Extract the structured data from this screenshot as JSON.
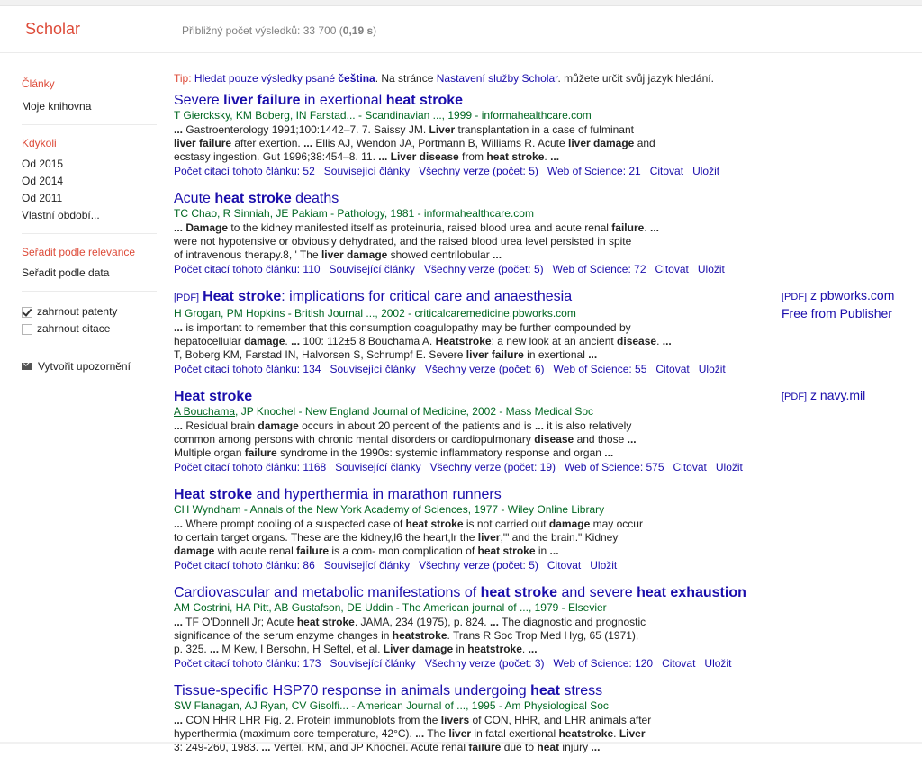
{
  "header": {
    "logo": "Scholar",
    "count_prefix": "Přibližný počet výsledků: 33 700 (",
    "count_time": "0,19 s",
    "count_suffix": ")"
  },
  "sidebar": {
    "articles_label": "Články",
    "my_library": "Moje knihovna",
    "when_label": "Kdykoli",
    "years": [
      "Od 2015",
      "Od 2014",
      "Od 2011",
      "Vlastní období..."
    ],
    "sort_relevance": "Seřadit podle relevance",
    "sort_date": "Seřadit podle data",
    "include_patents": "zahrnout patenty",
    "include_patents_checked": true,
    "include_citations": "zahrnout citace",
    "include_citations_checked": false,
    "create_alert": "Vytvořit upozornění"
  },
  "tip": {
    "label": "Tip:",
    "link1": "Hledat pouze výsledky psané",
    "lang": "čeština",
    "mid": ". Na stránce",
    "link2": "Nastavení služby Scholar",
    "tail": ". můžete určit svůj jazyk hledání."
  },
  "results": [
    {
      "title_html": "Severe <b>liver failure</b> in exertional <b>heat stroke</b>",
      "pdf_tag": "",
      "authors": "T Giercksky, KM Boberg, IN Farstad... - Scandinavian ..., 1999 - informahealthcare.com",
      "snippet_html": "<b>...</b> Gastroenterology 1991;100:1442–7. 7. Saissy JM. <b>Liver</b> transplantation in a case of fulminant<br><b>liver failure</b> after exertion. <b>...</b> Ellis AJ, Wendon JA, Portmann B, Williams R. Acute <b>liver damage</b> and<br>ecstasy ingestion. Gut 1996;38:454–8. 11. <b>...</b> <b>Liver disease</b> from <b>heat stroke</b>. <b>...</b>",
      "footer": [
        "Počet citací tohoto článku: 52",
        "Související články",
        "Všechny verze (počet: 5)",
        "Web of Science: 21",
        "Citovat",
        "Uložit"
      ]
    },
    {
      "title_html": "Acute <b>heat stroke</b> deaths",
      "pdf_tag": "",
      "authors": "TC Chao, R Sinniah, JE Pakiam - Pathology, 1981 - informahealthcare.com",
      "snippet_html": "<b>... Damage</b> to the kidney manifested itself as proteinuria, raised blood urea and acute renal <b>failure</b>. <b>...</b><br>were not hypotensive or obviously dehydrated, and the raised blood urea level persisted in spite<br>of intravenous therapy.8, ' The <b>liver damage</b> showed centrilobular <b>...</b>",
      "footer": [
        "Počet citací tohoto článku: 110",
        "Související články",
        "Všechny verze (počet: 5)",
        "Web of Science: 72",
        "Citovat",
        "Uložit"
      ]
    },
    {
      "title_html": "<b>Heat stroke</b>: implications for critical care and anaesthesia",
      "pdf_tag": "[PDF]",
      "authors": "H Grogan, PM Hopkins - British Journal ..., 2002 - criticalcaremedicine.pbworks.com",
      "snippet_html": "<b>...</b> is important to remember that this consumption coagulopathy may be further compounded by<br>hepatocellular <b>damage</b>. <b>...</b> 100: 112±5 8 Bouchama A. <b>Heatstroke</b>: a new look at an ancient <b>disease</b>. <b>...</b><br>T, Boberg KM, Farstad IN, Halvorsen S, Schrumpf E. Severe <b>liver failure</b> in exertional <b>...</b>",
      "footer": [
        "Počet citací tohoto článku: 134",
        "Související články",
        "Všechny verze (počet: 6)",
        "Web of Science: 55",
        "Citovat",
        "Uložit"
      ]
    },
    {
      "title_html": "<b>Heat stroke</b>",
      "pdf_tag": "",
      "authors_link": "A Bouchama",
      "authors": ", JP Knochel - New England Journal of Medicine, 2002 - Mass Medical Soc",
      "snippet_html": "<b>...</b> Residual brain <b>damage</b> occurs in about 20 percent of the patients and is <b>...</b> it is also relatively<br>common among persons with chronic mental disorders or cardiopulmonary <b>disease</b> and those <b>...</b><br>Multiple organ <b>failure</b> syndrome in the 1990s: systemic inflammatory response and organ <b>...</b>",
      "footer": [
        "Počet citací tohoto článku: 1168",
        "Související články",
        "Všechny verze (počet: 19)",
        "Web of Science: 575",
        "Citovat",
        "Uložit"
      ]
    },
    {
      "title_html": "<b>Heat stroke</b> and hyperthermia in marathon runners",
      "pdf_tag": "",
      "authors": "CH Wyndham - Annals of the New York Academy of Sciences, 1977 - Wiley Online Library",
      "snippet_html": "<b>...</b> Where prompt cooling of a suspected case of <b>heat stroke</b> is not carried out <b>damage</b> may occur<br>to certain target organs. These are the kidney,l6 the heart,lr the <b>liver</b>,'\" and the brain.\" Kidney<br><b>damage</b> with acute renal <b>failure</b> is a com- mon complication of <b>heat stroke</b> in <b>...</b>",
      "footer": [
        "Počet citací tohoto článku: 86",
        "Související články",
        "Všechny verze (počet: 5)",
        "Citovat",
        "Uložit"
      ]
    },
    {
      "title_html": "Cardiovascular and metabolic manifestations of <b>heat stroke</b> and severe <b>heat exhaustion</b>",
      "pdf_tag": "",
      "authors": "AM Costrini, HA Pitt, AB Gustafson, DE Uddin - The American journal of ..., 1979 - Elsevier",
      "snippet_html": "<b>...</b> TF O'Donnell Jr; Acute <b>heat stroke</b>. JAMA, 234 (1975), p. 824. <b>...</b> The diagnostic and prognostic<br>significance of the serum enzyme changes in <b>heatstroke</b>. Trans R Soc Trop Med Hyg, 65 (1971),<br>p. 325. <b>...</b> M Kew, I Bersohn, H Seftel, et al. <b>Liver damage</b> in <b>heatstroke</b>. <b>...</b>",
      "footer": [
        "Počet citací tohoto článku: 173",
        "Související články",
        "Všechny verze (počet: 3)",
        "Web of Science: 120",
        "Citovat",
        "Uložit"
      ]
    },
    {
      "title_html": "Tissue-specific HSP70 response in animals undergoing <b>heat</b> stress",
      "pdf_tag": "",
      "authors": "SW Flanagan, AJ Ryan, CV Gisolfi... - American Journal of ..., 1995 - Am Physiological Soc",
      "snippet_html": "<b>...</b> CON HHR LHR Fig. 2. Protein immunoblots from the <b>livers</b> of CON, HHR, and LHR animals after<br>hyperthermia (maximum core temperature, 42°C). <b>...</b> The <b>liver</b> in fatal exertional <b>heatstroke</b>. <b>Liver</b><br>3: 249-260, 1983. <b>...</b> Vertel, RM, and JP Knochel. Acute renal <b>failure</b> due to <b>heat</b> injury <b>...</b>",
      "footer": []
    }
  ],
  "side_links": [
    {
      "tag": "[PDF]",
      "text": "z pbworks.com",
      "extra": "Free from Publisher"
    },
    {
      "tag": "[PDF]",
      "text": "z navy.mil",
      "extra": ""
    }
  ]
}
